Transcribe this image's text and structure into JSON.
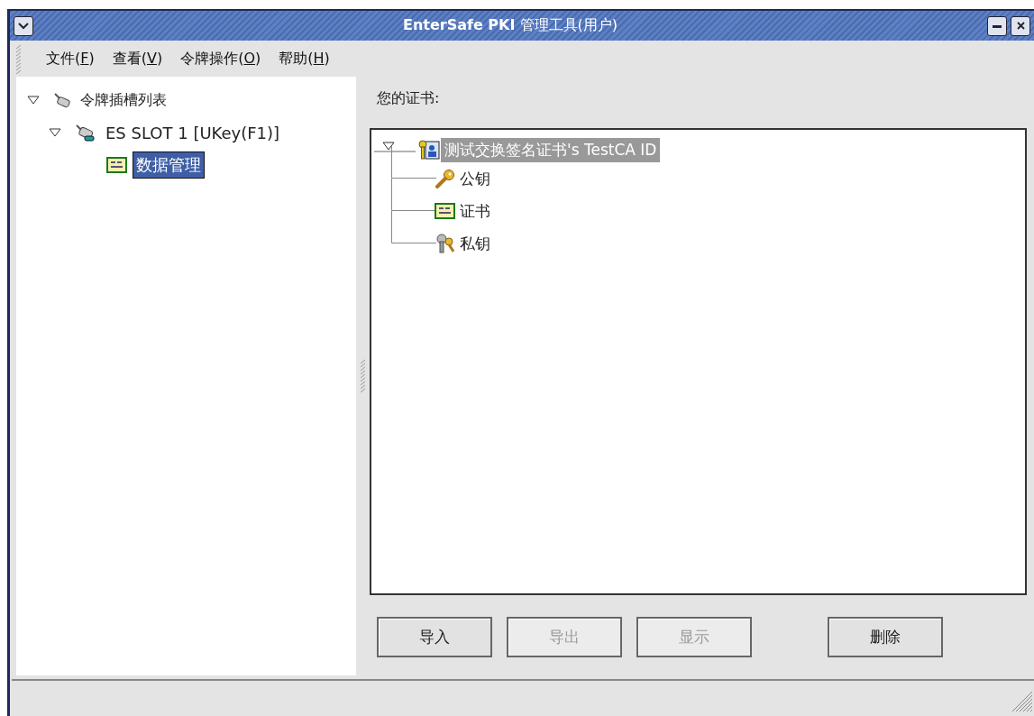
{
  "window": {
    "title": "**EnterSafe PKI** 管理工具(用户)"
  },
  "menu": [
    {
      "before": "文件(",
      "key": "F",
      "after": ")"
    },
    {
      "before": "查看(",
      "key": "V",
      "after": ")"
    },
    {
      "before": "令牌操作(",
      "key": "O",
      "after": ")"
    },
    {
      "before": "帮助(",
      "key": "H",
      "after": ")"
    }
  ],
  "slot_tree": [
    {
      "label": "令牌插槽列表",
      "kind": "reader",
      "expanded": true,
      "selected": false,
      "children": [
        {
          "label": "ES SLOT 1 [UKey(F1)]",
          "kind": "token",
          "expanded": true,
          "selected": false,
          "children": [
            {
              "label": "数据管理",
              "kind": "certificate",
              "selected": true
            }
          ]
        }
      ]
    }
  ],
  "certificates": {
    "label": "您的证书:",
    "tree": {
      "label": "测试交换签名证书's TestCA ID",
      "kind": "identity",
      "expanded": true,
      "selected": true,
      "children": [
        {
          "label": "公钥",
          "kind": "key"
        },
        {
          "label": "证书",
          "kind": "certificate"
        },
        {
          "label": "私钥",
          "kind": "private-key"
        }
      ]
    }
  },
  "buttons": [
    {
      "label": "导入",
      "disabled": false
    },
    {
      "label": "导出",
      "disabled": true
    },
    {
      "label": "显示",
      "disabled": true
    },
    {
      "label": "删除",
      "disabled": false
    }
  ]
}
